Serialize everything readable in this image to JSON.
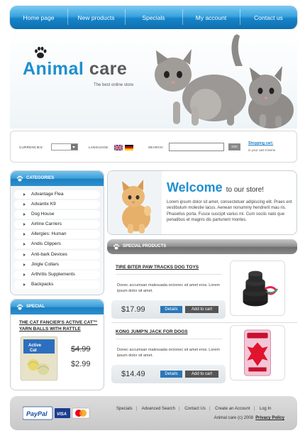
{
  "nav": {
    "items": [
      "Home page",
      "New products",
      "Specials",
      "My account",
      "Contact us"
    ]
  },
  "header": {
    "logo_word1": "Animal",
    "logo_word2": "care",
    "tagline": "The best online store"
  },
  "search_bar": {
    "currencies_label": "Currencies:",
    "language_label": "Language:",
    "search_label": "Search:",
    "search_value": "",
    "go_label": "GO!",
    "cart_title": "Shopping cart:",
    "cart_status": "in your cart 0 items",
    "flags": [
      "uk-flag-icon",
      "germany-flag-icon"
    ]
  },
  "categories": {
    "heading": "Categories",
    "items": [
      "Advantage Flea",
      "Advantix K9",
      "Dog House",
      "Airline Carriers",
      "Allergies: Human",
      "Andis Clippers",
      "Anti-bark Devices",
      "Jingle Collars",
      "Arthritis Supplements",
      "Backpacks"
    ]
  },
  "special": {
    "heading": "Special",
    "title": "The Cat Fancier's Active Cat™ Yarn Balls with Rattle",
    "old_price": "$4.99",
    "new_price": "$2.99"
  },
  "welcome": {
    "heading": "Welcome",
    "heading_suffix": "to our store!",
    "text": "Lorem ipsum dolor sit amet, consectetuer adipiscing elit. Praes ent vestibulum molestie lacus. Aenean nonummy hendrerit mau ris. Phasellus porta. Fusce suscipit varius mi. Cum sociis nato que penatibus et magnis dis parturient montes."
  },
  "special_products": {
    "heading": "Special Products",
    "details_label": "Details",
    "add_to_cart_label": "Add to cart",
    "items": [
      {
        "name": "Tire Biter Paw Tracks Dog Toys",
        "desc": "Donec accumsan malesuada orcionec sit amet eros. Lorem ipsum dolor sit amet.",
        "price": "$17.99"
      },
      {
        "name": "Kong Jump'n Jack for Dogs",
        "desc": "Donec accumsan malesuada orcionec sit amet eros. Lorem ipsum dolor sit amet.",
        "price": "$14.49"
      }
    ]
  },
  "footer": {
    "links": [
      "Specials",
      "Advanced Search",
      "Contact Us",
      "Create an Account",
      "Log In"
    ],
    "copyright": "Animal care (c) 2008",
    "privacy": "Privacy Policy",
    "payment_paypal": "PayPal",
    "payment_visa": "VISA",
    "payment_mastercard": "MasterCard"
  },
  "colors": {
    "brand_blue": "#1e8fcf",
    "nav_blue": "#1684c8",
    "details_button": "#2b77b8"
  }
}
